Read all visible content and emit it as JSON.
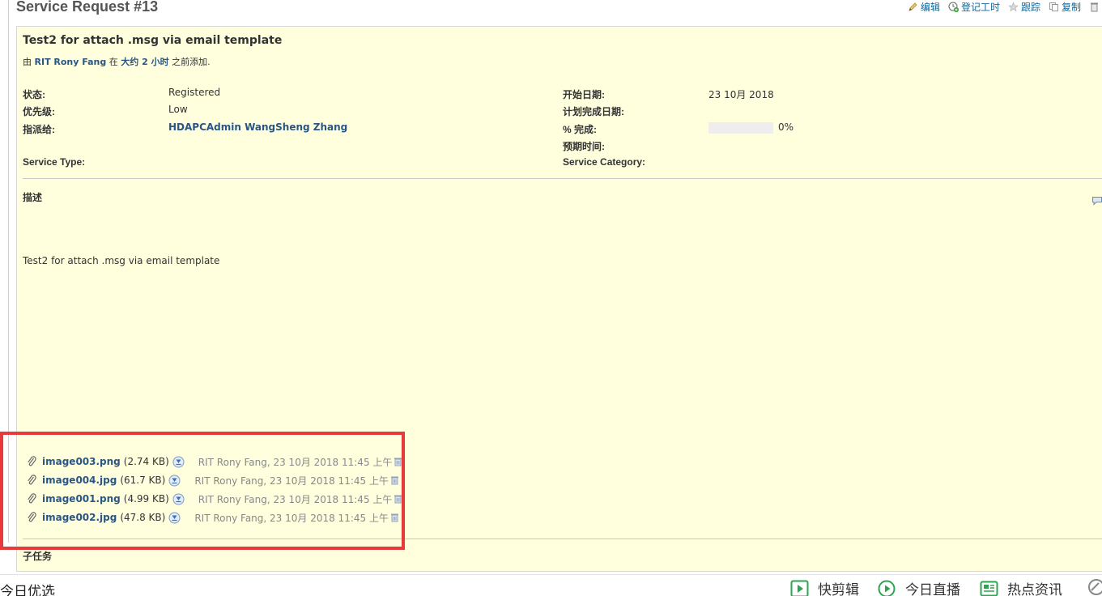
{
  "page": {
    "title": "Service Request #13"
  },
  "actions": {
    "edit": "编辑",
    "log_time": "登记工时",
    "watch": "跟踪",
    "copy": "复制"
  },
  "issue": {
    "subject": "Test2 for attach .msg via email template",
    "author_prefix": "由",
    "author_name": "RIT Rony Fang",
    "author_mid": "在",
    "author_time": "大约 2 小时",
    "author_suffix": "之前添加."
  },
  "attributes": {
    "status_label": "状态:",
    "status_value": "Registered",
    "priority_label": "优先级:",
    "priority_value": "Low",
    "assignee_label": "指派给:",
    "assignee_value": "HDAPCAdmin WangSheng Zhang",
    "service_type_label": "Service Type:",
    "start_date_label": "开始日期:",
    "start_date_value": "23 10月 2018",
    "due_date_label": "计划完成日期:",
    "done_ratio_label": "% 完成:",
    "done_ratio_value": "0%",
    "done_ratio_fraction": 0,
    "estimated_label": "预期时间:",
    "service_category_label": "Service Category:"
  },
  "description": {
    "title": "描述",
    "body": "Test2 for attach .msg via email template"
  },
  "attachments": [
    {
      "name": "image003.png",
      "size": "(2.74 KB)",
      "meta": "RIT Rony Fang, 23 10月 2018 11:45 上午"
    },
    {
      "name": "image004.jpg",
      "size": "(61.7 KB)",
      "meta": "RIT Rony Fang, 23 10月 2018 11:45 上午"
    },
    {
      "name": "image001.png",
      "size": "(4.99 KB)",
      "meta": "RIT Rony Fang, 23 10月 2018 11:45 上午"
    },
    {
      "name": "image002.jpg",
      "size": "(47.8 KB)",
      "meta": "RIT Rony Fang, 23 10月 2018 11:45 上午"
    }
  ],
  "subtasks": {
    "title": "子任务"
  },
  "taskbar": {
    "brand": "今日优选",
    "items": [
      "快剪辑",
      "今日直播",
      "热点资讯"
    ]
  },
  "colors": {
    "link": "#2a5685",
    "panel_bg": "#ffffdd",
    "highlight": "#e83a3a",
    "taskbar_icon": "#2ea44f"
  }
}
